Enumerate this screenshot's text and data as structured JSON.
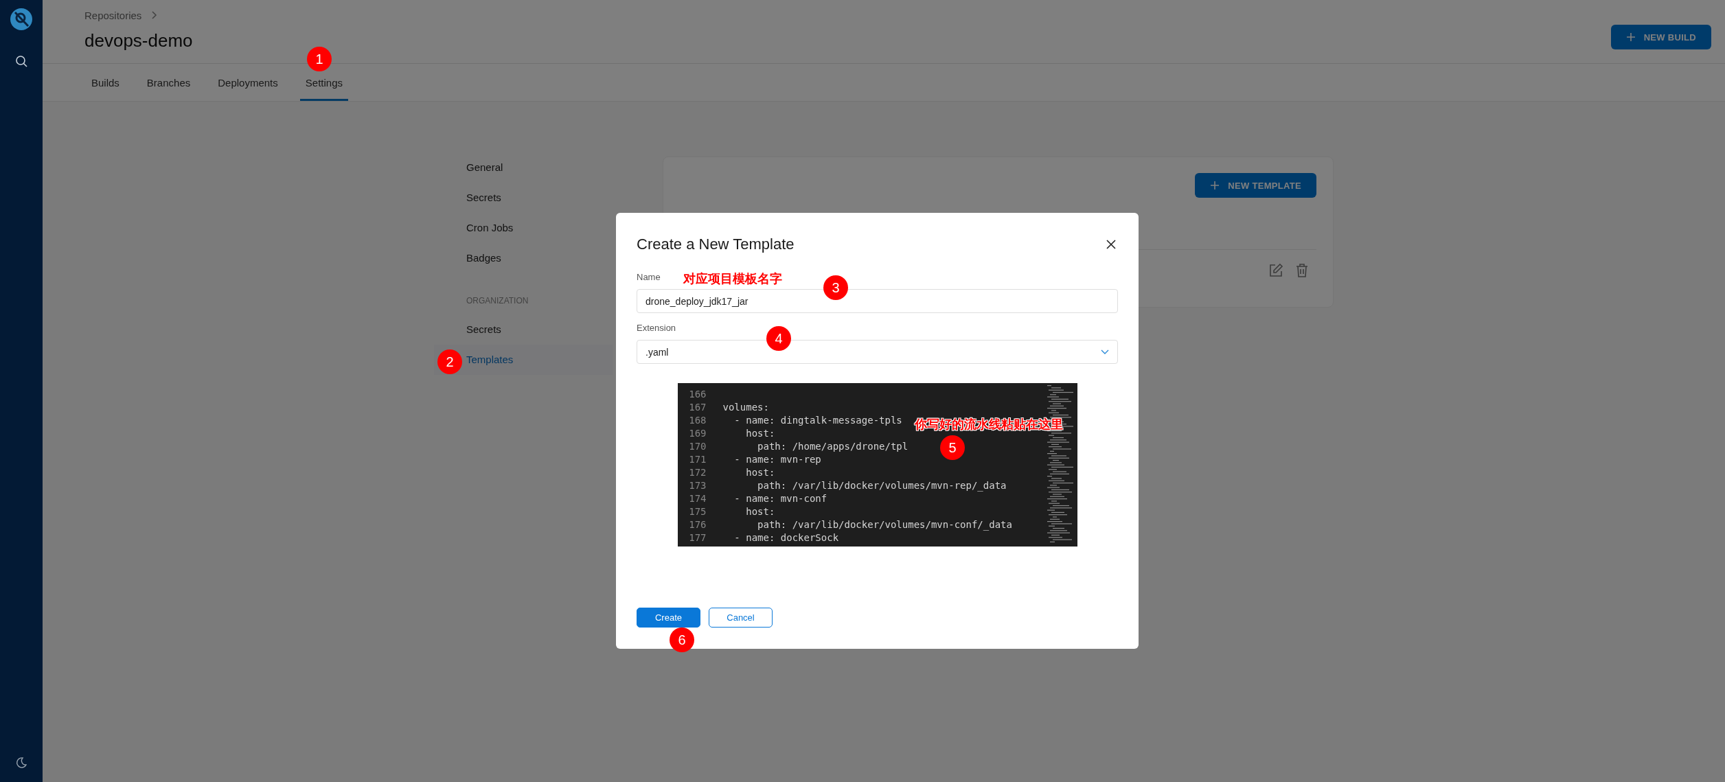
{
  "breadcrumb": {
    "items": [
      "Repositories"
    ]
  },
  "repo_title": "devops-demo",
  "new_build_button": "NEW BUILD",
  "tabs": [
    {
      "label": "Builds",
      "selected": false
    },
    {
      "label": "Branches",
      "selected": false
    },
    {
      "label": "Deployments",
      "selected": false
    },
    {
      "label": "Settings",
      "selected": true
    }
  ],
  "settings_menu": {
    "repo_items": [
      {
        "label": "General",
        "selected": false
      },
      {
        "label": "Secrets",
        "selected": false
      },
      {
        "label": "Cron Jobs",
        "selected": false
      },
      {
        "label": "Badges",
        "selected": false
      }
    ],
    "section_title": "ORGANIZATION",
    "org_items": [
      {
        "label": "Secrets",
        "selected": false
      },
      {
        "label": "Templates",
        "selected": true
      }
    ]
  },
  "templates_card": {
    "new_template_button": "NEW TEMPLATE"
  },
  "modal": {
    "title": "Create a New Template",
    "fields": [
      {
        "kind": "text",
        "label": "Name",
        "value": "drone_deploy_jdk17_jar"
      },
      {
        "kind": "select",
        "label": "Extension",
        "value": ".yaml"
      }
    ],
    "code_preview": {
      "lines": [
        {
          "number": "166"
        },
        {
          "number": "167",
          "text": "volumes:"
        },
        {
          "number": "168",
          "text": "  - name: dingtalk-message-tpls"
        },
        {
          "number": "169",
          "text": "    host:"
        },
        {
          "number": "170",
          "text": "      path: /home/apps/drone/tpl"
        },
        {
          "number": "171",
          "text": "  - name: mvn-rep"
        },
        {
          "number": "172",
          "text": "    host:"
        },
        {
          "number": "173",
          "text": "      path: /var/lib/docker/volumes/mvn-rep/_data"
        },
        {
          "number": "174",
          "text": "  - name: mvn-conf"
        },
        {
          "number": "175",
          "text": "    host:"
        },
        {
          "number": "176",
          "text": "      path: /var/lib/docker/volumes/mvn-conf/_data"
        },
        {
          "number": "177",
          "text": "  - name: dockerSock"
        }
      ]
    },
    "buttons": [
      {
        "kind": "primary",
        "label": "Create"
      },
      {
        "kind": "secondary",
        "label": "Cancel"
      }
    ]
  },
  "annotations": [
    {
      "number": "1"
    },
    {
      "number": "2"
    },
    {
      "number": "3",
      "note": "对应项目模板名字"
    },
    {
      "number": "4"
    },
    {
      "number": "5",
      "note": "你写好的流水线粘贴在这里"
    },
    {
      "number": "6"
    }
  ]
}
